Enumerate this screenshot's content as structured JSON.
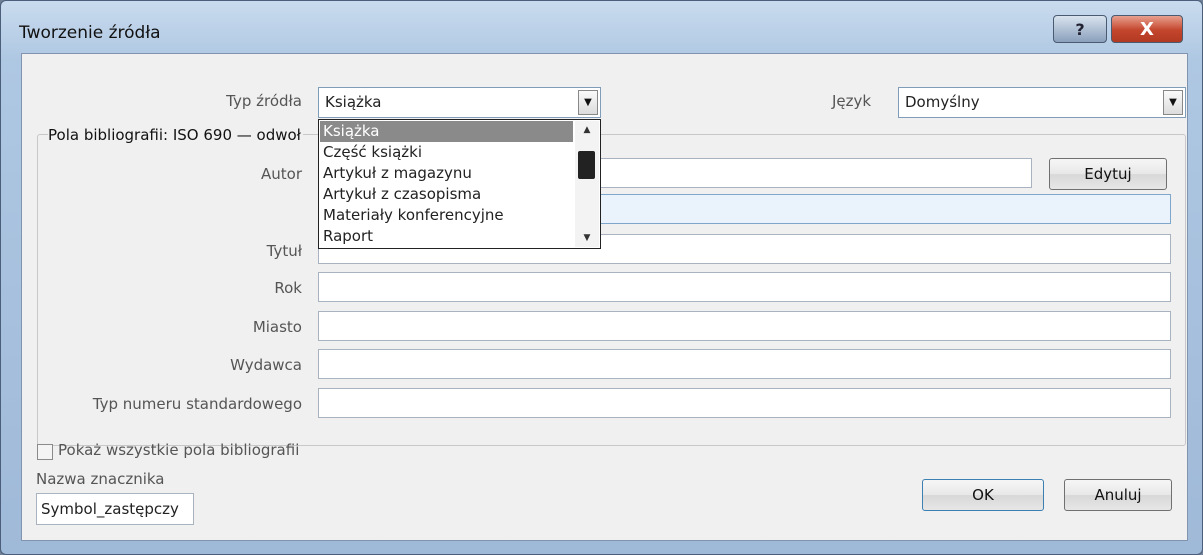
{
  "window": {
    "title": "Tworzenie źródła",
    "help_label": "?",
    "close_label": "X"
  },
  "source_type": {
    "label": "Typ źródła",
    "value": "Książka",
    "options": [
      "Książka",
      "Część książki",
      "Artykuł z magazynu",
      "Artykuł z czasopisma",
      "Materiały konferencyjne",
      "Raport"
    ]
  },
  "language": {
    "label": "Język",
    "value": "Domyślny"
  },
  "group_title": "Pola bibliografii: ISO 690 — odwoł",
  "fields": {
    "author_label": "Autor",
    "title_label": "Tytuł",
    "year_label": "Rok",
    "city_label": "Miasto",
    "publisher_label": "Wydawca",
    "std_number_label": "Typ numeru standardowego"
  },
  "edit_button": "Edytuj",
  "show_all_label": "Pokaż wszystkie pola bibliografii",
  "tag": {
    "label": "Nazwa znacznika",
    "value": "Symbol_zastępczy"
  },
  "buttons": {
    "ok": "OK",
    "cancel": "Anuluj"
  }
}
